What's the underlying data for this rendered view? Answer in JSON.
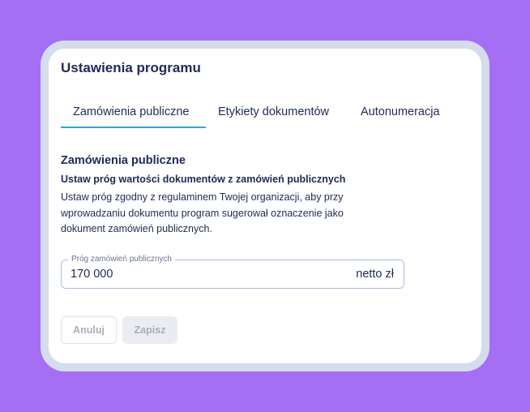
{
  "dialog": {
    "title": "Ustawienia programu"
  },
  "tabs": [
    {
      "label": "Zamówienia publiczne",
      "active": true
    },
    {
      "label": "Etykiety dokumentów",
      "active": false
    },
    {
      "label": "Autonumeracja",
      "active": false
    }
  ],
  "section": {
    "title": "Zamówienia publiczne",
    "subtitle": "Ustaw próg wartości dokumentów z zamówień publicznych",
    "description": "Ustaw próg zgodny z regulaminem Twojej organizacji, aby przy wprowadzaniu dokumentu program sugerował oznaczenie jako dokument zamówień publicznych."
  },
  "threshold_field": {
    "label": "Próg zamówień publicznych",
    "value": "170 000",
    "suffix": "netto zł"
  },
  "buttons": {
    "cancel": "Anuluj",
    "save": "Zapisz"
  },
  "colors": {
    "background": "#a56ff5",
    "frame": "#d5dcec",
    "text": "#1f2a55",
    "accent": "#2aa8d8",
    "disabled_text": "#a8aebd"
  }
}
